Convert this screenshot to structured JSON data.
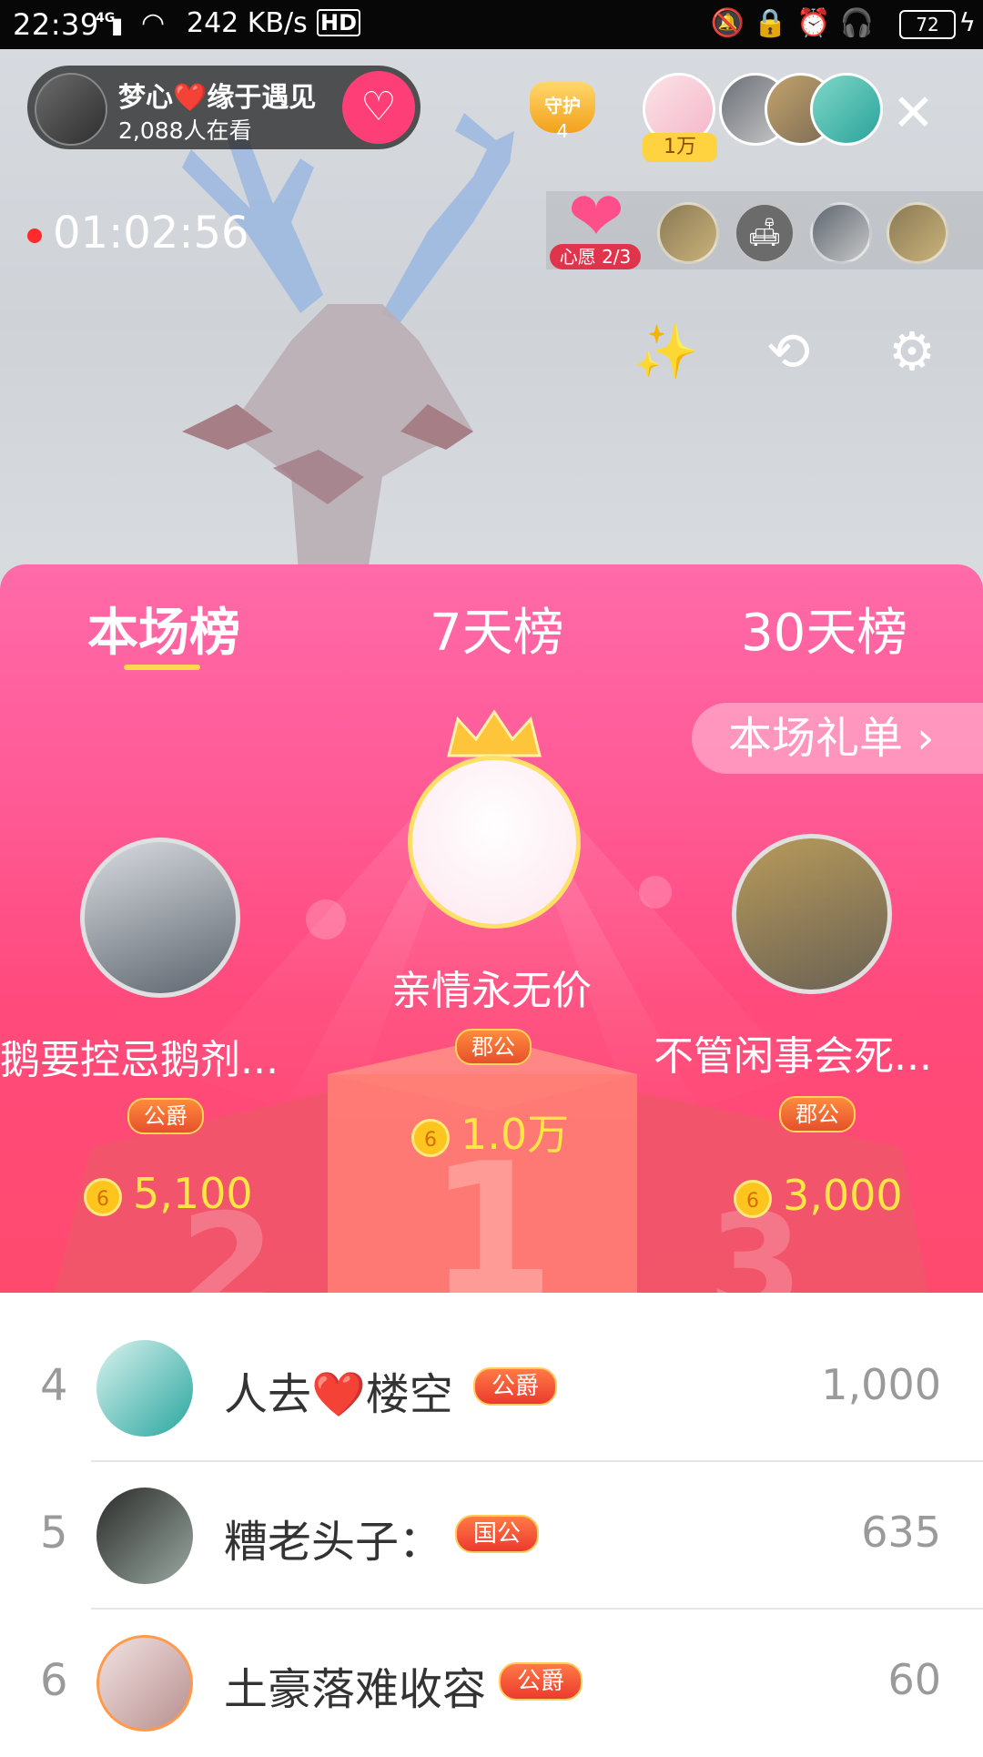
{
  "status_bar": {
    "time": "22:39",
    "network": "4G",
    "speed": "242 KB/s",
    "hd": "HD",
    "battery": "72"
  },
  "host": {
    "name": "梦心❤️缘于遇见",
    "viewers": "2,088人在看"
  },
  "guard": {
    "label": "守护",
    "count": "4"
  },
  "top_rank_badge": "1万",
  "live_timer": "01:02:56",
  "wish": {
    "label": "心愿 2/3"
  },
  "tabs": [
    {
      "label": "本场榜",
      "active": true
    },
    {
      "label": "7天榜",
      "active": false
    },
    {
      "label": "30天榜",
      "active": false
    }
  ],
  "gift_list_link": "本场礼单 ›",
  "podium": {
    "first": {
      "name": "亲情永无价",
      "badge": "郡公",
      "score": "1.0万"
    },
    "second": {
      "name": "鹅要控忌鹅剂...",
      "badge": "公爵",
      "score": "5,100"
    },
    "third": {
      "name": "不管闲事会死...",
      "badge": "郡公",
      "score": "3,000"
    }
  },
  "ranking_rows": [
    {
      "rank": "4",
      "name": "人去❤️楼空",
      "badge": "公爵",
      "score": "1,000"
    },
    {
      "rank": "5",
      "name": "糟老头子：",
      "badge": "国公",
      "score": "635"
    },
    {
      "rank": "6",
      "name": "土豪落难收容",
      "badge": "公爵",
      "score": "60"
    }
  ],
  "colors": {
    "panel_top": "#ff6aa8",
    "panel_bottom": "#ff4a6e",
    "coin_text": "#ffe545",
    "tab_underline": "#ffd84d",
    "follow_button": "#fe3f77"
  }
}
